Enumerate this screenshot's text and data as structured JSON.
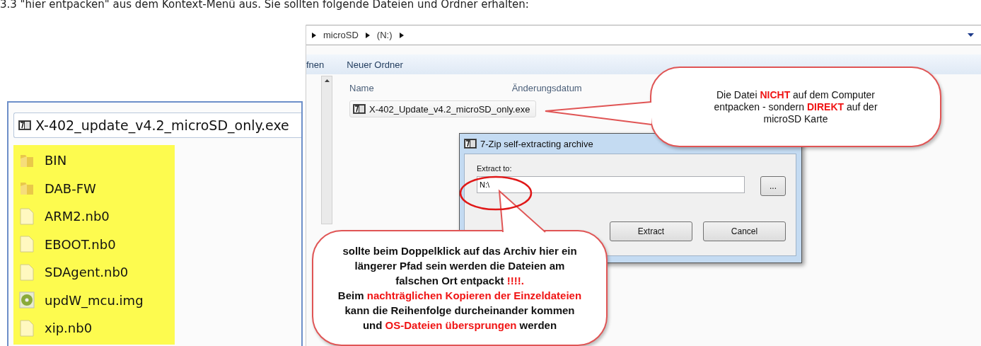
{
  "intro": "3.3 \"hier entpacken\" aus dem Kontext-Menü aus. Sie sollten folgende Dateien und Ordner erhalten:",
  "listing": {
    "archive": "X-402_update_v4.2_microSD_only.exe",
    "highlighted": true,
    "items": [
      {
        "name": "BIN",
        "kind": "folder"
      },
      {
        "name": "DAB-FW",
        "kind": "folder"
      },
      {
        "name": "ARM2.nb0",
        "kind": "file"
      },
      {
        "name": "EBOOT.nb0",
        "kind": "file"
      },
      {
        "name": "SDAgent.nb0",
        "kind": "file"
      },
      {
        "name": "updW_mcu.img",
        "kind": "disc"
      },
      {
        "name": "xip.nb0",
        "kind": "file"
      }
    ]
  },
  "explorer": {
    "path": [
      "microSD",
      "(N:)"
    ],
    "toolbar": [
      "fnen",
      "Neuer Ordner"
    ],
    "columns": [
      "Name",
      "Änderungsdatum"
    ],
    "file": "X-402_Update_v4.2_microSD_only.exe"
  },
  "dialog": {
    "title": "7-Zip self-extracting archive",
    "label": "Extract to:",
    "value": "N:\\",
    "browse": "...",
    "buttons": [
      "Extract",
      "Cancel"
    ]
  },
  "callouts": [
    {
      "bold": false,
      "lines": [
        [
          {
            "text": "Die Datei ",
            "emphasis": false
          },
          {
            "text": "NICHT",
            "emphasis": true
          },
          {
            "text": " auf dem Computer",
            "emphasis": false
          }
        ],
        [
          {
            "text": "entpacken - sondern ",
            "emphasis": false
          },
          {
            "text": "DIREKT",
            "emphasis": true
          },
          {
            "text": " auf der",
            "emphasis": false
          }
        ],
        [
          {
            "text": "microSD Karte",
            "emphasis": false
          }
        ]
      ]
    },
    {
      "bold": true,
      "lines": [
        [
          {
            "text": "sollte beim Doppelklick auf das Archiv hier ein",
            "emphasis": false
          }
        ],
        [
          {
            "text": "längerer Pfad sein werden die Dateien am",
            "emphasis": false
          }
        ],
        [
          {
            "text": "falschen Ort entpackt ",
            "emphasis": false
          },
          {
            "text": "!!!!.",
            "emphasis": true
          }
        ],
        [
          {
            "text": "Beim ",
            "emphasis": false
          },
          {
            "text": "nachträglichen Kopieren der Einzeldateien",
            "emphasis": true
          }
        ],
        [
          {
            "text": "kann die Reihenfolge durcheinander kommen",
            "emphasis": false
          }
        ],
        [
          {
            "text": "und ",
            "emphasis": false
          },
          {
            "text": "OS-Dateien übersprungen",
            "emphasis": true
          },
          {
            "text": " werden",
            "emphasis": false
          }
        ]
      ]
    }
  ]
}
